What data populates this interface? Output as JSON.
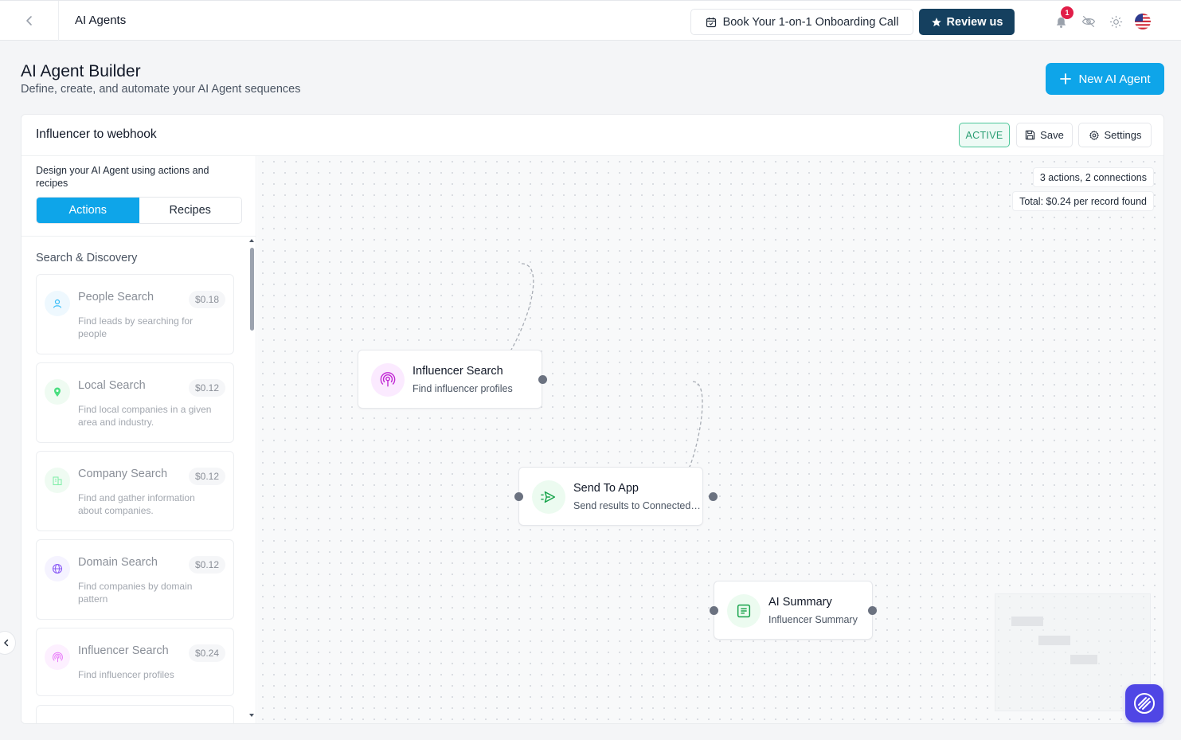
{
  "topbar": {
    "title": "AI Agents",
    "book_call_label": "Book Your 1-on-1 Onboarding Call",
    "review_label": "Review us",
    "notification_count": "1"
  },
  "header": {
    "title": "AI Agent Builder",
    "subtitle": "Define, create, and automate your AI Agent sequences",
    "new_agent_label": "New AI Agent"
  },
  "builder": {
    "agent_name": "Influencer to webhook",
    "status": "ACTIVE",
    "save_label": "Save",
    "settings_label": "Settings"
  },
  "sidebar": {
    "description": "Design your AI Agent using actions and recipes",
    "tabs": [
      {
        "label": "Actions",
        "active": true
      },
      {
        "label": "Recipes",
        "active": false
      }
    ],
    "section_title": "Search & Discovery",
    "actions": [
      {
        "name": "People Search",
        "price": "$0.18",
        "description": "Find leads by searching for people",
        "icon": "person-icon",
        "color": "#38bdf8"
      },
      {
        "name": "Local Search",
        "price": "$0.12",
        "description": "Find local companies in a given area and industry.",
        "icon": "map-pin-icon",
        "color": "#22c55e"
      },
      {
        "name": "Company Search",
        "price": "$0.12",
        "description": "Find and gather information about companies.",
        "icon": "building-icon",
        "color": "#4ade80"
      },
      {
        "name": "Domain Search",
        "price": "$0.12",
        "description": "Find companies by domain pattern",
        "icon": "globe-icon",
        "color": "#8b5cf6"
      },
      {
        "name": "Influencer Search",
        "price": "$0.24",
        "description": "Find influencer profiles",
        "icon": "podcast-icon",
        "color": "#d946ef"
      }
    ]
  },
  "canvas": {
    "summary": "3 actions, 2 connections",
    "total": "Total: $0.24 per record found",
    "nodes": [
      {
        "name": "Influencer Search",
        "subtitle": "Find influencer profiles",
        "icon": "podcast-icon",
        "color": "#c026d3"
      },
      {
        "name": "Send To App",
        "subtitle": "Send results to Connected Apps",
        "icon": "send-icon",
        "color": "#16a34a"
      },
      {
        "name": "AI Summary",
        "subtitle": "Influencer Summary",
        "icon": "document-icon",
        "color": "#16a34a"
      }
    ]
  }
}
